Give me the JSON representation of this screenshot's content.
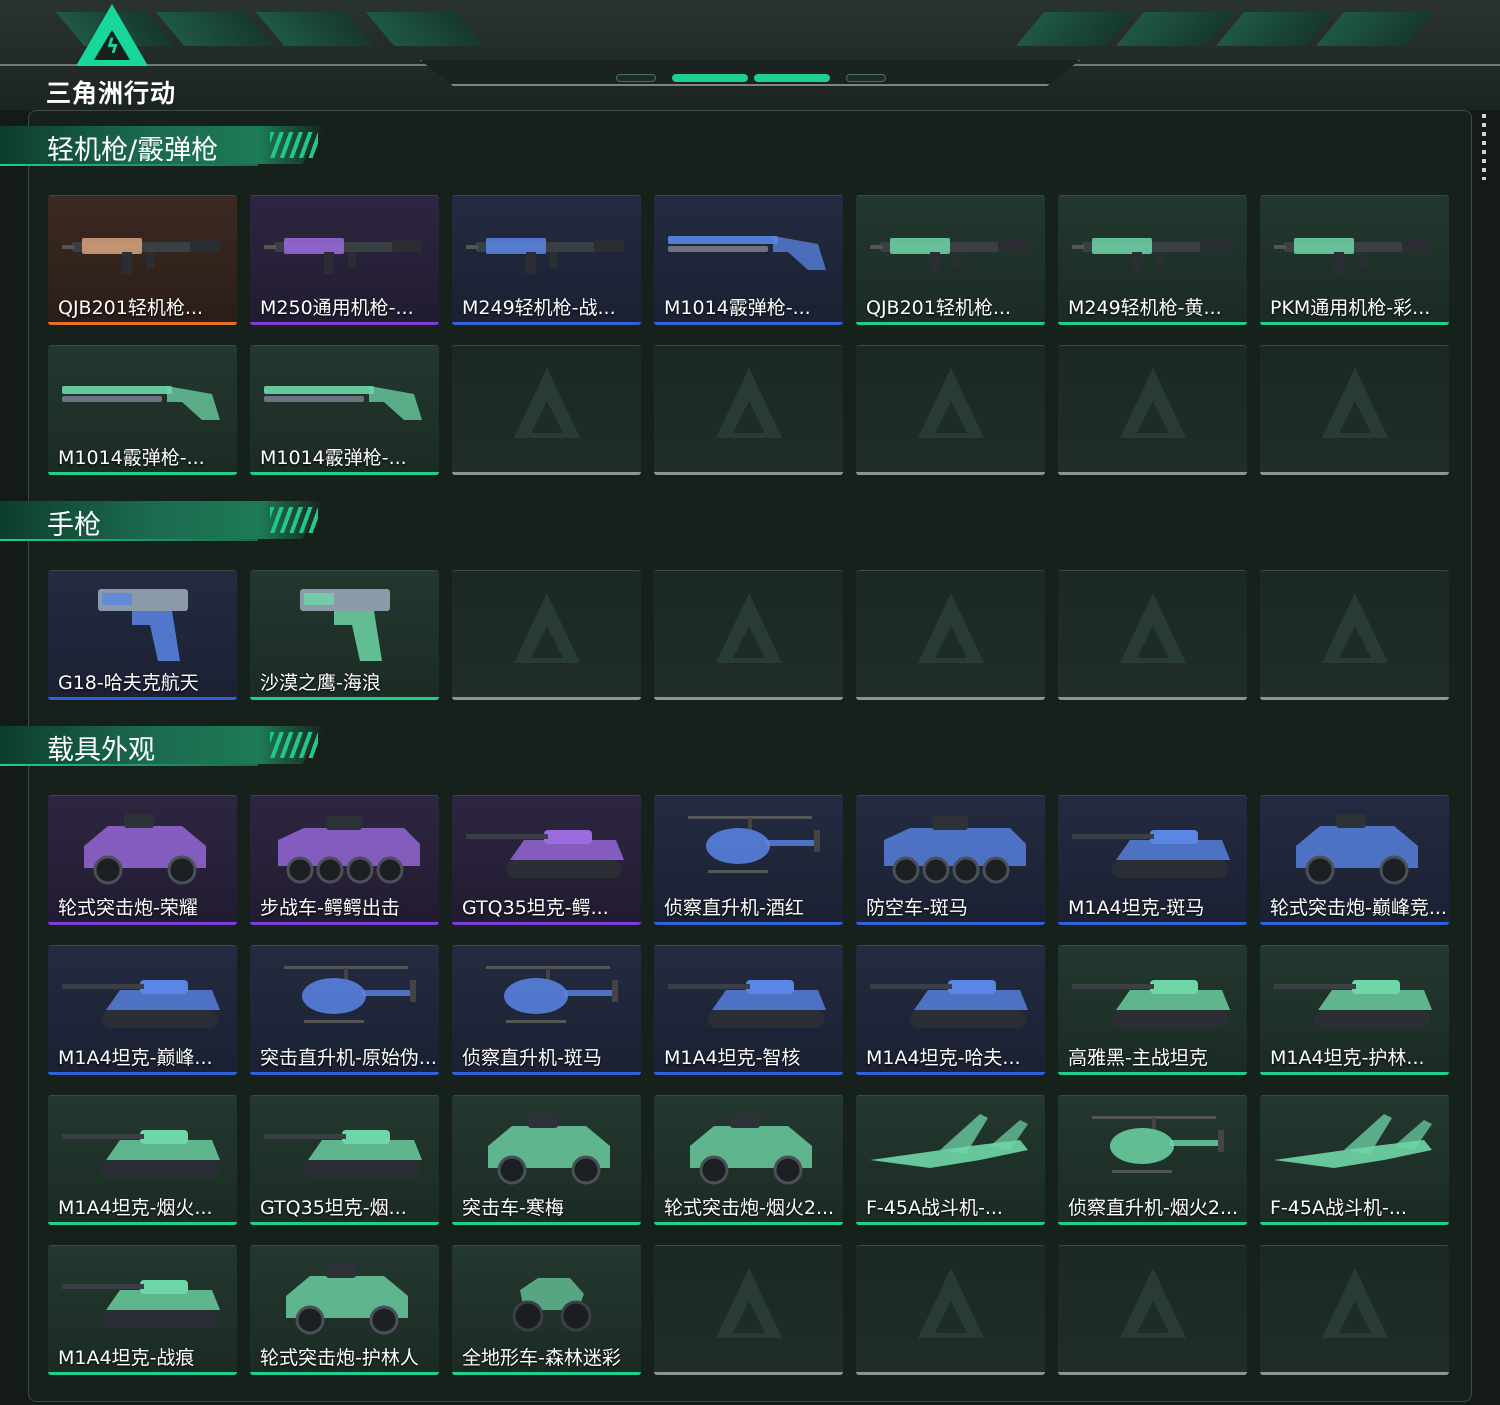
{
  "app": {
    "logo_text": "三角洲行动"
  },
  "colors": {
    "orange": "#e6722a",
    "purple": "#7a3fd6",
    "blue": "#2f62d8",
    "green": "#1fcf8e",
    "empty": "#8c9590"
  },
  "sections": [
    {
      "title": "轻机枪/霰弹枪",
      "items": [
        {
          "label": "QJB201轻机枪...",
          "rarity": "orange",
          "icon": "machine-gun-icon"
        },
        {
          "label": "M250通用机枪-...",
          "rarity": "purple",
          "icon": "machine-gun-icon"
        },
        {
          "label": "M249轻机枪-战...",
          "rarity": "blue",
          "icon": "machine-gun-icon"
        },
        {
          "label": "M1014霰弹枪-...",
          "rarity": "blue",
          "icon": "shotgun-icon"
        },
        {
          "label": "QJB201轻机枪...",
          "rarity": "green",
          "icon": "machine-gun-icon"
        },
        {
          "label": "M249轻机枪-黄...",
          "rarity": "green",
          "icon": "machine-gun-icon"
        },
        {
          "label": "PKM通用机枪-彩...",
          "rarity": "green",
          "icon": "machine-gun-icon"
        },
        {
          "label": "M1014霰弹枪-...",
          "rarity": "green",
          "icon": "shotgun-icon"
        },
        {
          "label": "M1014霰弹枪-...",
          "rarity": "green",
          "icon": "shotgun-icon"
        },
        {
          "label": "",
          "rarity": "empty"
        },
        {
          "label": "",
          "rarity": "empty"
        },
        {
          "label": "",
          "rarity": "empty"
        },
        {
          "label": "",
          "rarity": "empty"
        },
        {
          "label": "",
          "rarity": "empty"
        }
      ]
    },
    {
      "title": "手枪",
      "items": [
        {
          "label": "G18-哈夫克航天",
          "rarity": "blue",
          "icon": "pistol-icon"
        },
        {
          "label": "沙漠之鹰-海浪",
          "rarity": "green",
          "icon": "pistol-icon"
        },
        {
          "label": "",
          "rarity": "empty"
        },
        {
          "label": "",
          "rarity": "empty"
        },
        {
          "label": "",
          "rarity": "empty"
        },
        {
          "label": "",
          "rarity": "empty"
        },
        {
          "label": "",
          "rarity": "empty"
        }
      ]
    },
    {
      "title": "载具外观",
      "items": [
        {
          "label": "轮式突击炮-荣耀",
          "rarity": "purple",
          "icon": "armored-car-icon"
        },
        {
          "label": "步战车-鳄鳄出击",
          "rarity": "purple",
          "icon": "ifv-icon"
        },
        {
          "label": "GTQ35坦克-鳄...",
          "rarity": "purple",
          "icon": "tank-icon"
        },
        {
          "label": "侦察直升机-酒红",
          "rarity": "blue",
          "icon": "helicopter-icon"
        },
        {
          "label": "防空车-斑马",
          "rarity": "blue",
          "icon": "ifv-icon"
        },
        {
          "label": "M1A4坦克-斑马",
          "rarity": "blue",
          "icon": "tank-icon"
        },
        {
          "label": "轮式突击炮-巅峰竞...",
          "rarity": "blue",
          "icon": "armored-car-icon"
        },
        {
          "label": "M1A4坦克-巅峰...",
          "rarity": "blue",
          "icon": "tank-icon"
        },
        {
          "label": "突击直升机-原始伪...",
          "rarity": "blue",
          "icon": "helicopter-icon"
        },
        {
          "label": "侦察直升机-斑马",
          "rarity": "blue",
          "icon": "helicopter-icon"
        },
        {
          "label": "M1A4坦克-智核",
          "rarity": "blue",
          "icon": "tank-icon"
        },
        {
          "label": "M1A4坦克-哈夫...",
          "rarity": "blue",
          "icon": "tank-icon"
        },
        {
          "label": "高雅黑-主战坦克",
          "rarity": "green",
          "icon": "tank-icon"
        },
        {
          "label": "M1A4坦克-护林...",
          "rarity": "green",
          "icon": "tank-icon"
        },
        {
          "label": "M1A4坦克-烟火...",
          "rarity": "green",
          "icon": "tank-icon"
        },
        {
          "label": "GTQ35坦克-烟...",
          "rarity": "green",
          "icon": "tank-icon"
        },
        {
          "label": "突击车-寒梅",
          "rarity": "green",
          "icon": "armored-car-icon"
        },
        {
          "label": "轮式突击炮-烟火2...",
          "rarity": "green",
          "icon": "armored-car-icon"
        },
        {
          "label": "F-45A战斗机-...",
          "rarity": "green",
          "icon": "jet-icon"
        },
        {
          "label": "侦察直升机-烟火2...",
          "rarity": "green",
          "icon": "helicopter-icon"
        },
        {
          "label": "F-45A战斗机-...",
          "rarity": "green",
          "icon": "jet-icon"
        },
        {
          "label": "M1A4坦克-战痕",
          "rarity": "green",
          "icon": "tank-icon"
        },
        {
          "label": "轮式突击炮-护林人",
          "rarity": "green",
          "icon": "armored-car-icon"
        },
        {
          "label": "全地形车-森林迷彩",
          "rarity": "green",
          "icon": "atv-icon"
        },
        {
          "label": "",
          "rarity": "empty"
        },
        {
          "label": "",
          "rarity": "empty"
        },
        {
          "label": "",
          "rarity": "empty"
        },
        {
          "label": "",
          "rarity": "empty"
        }
      ]
    }
  ]
}
